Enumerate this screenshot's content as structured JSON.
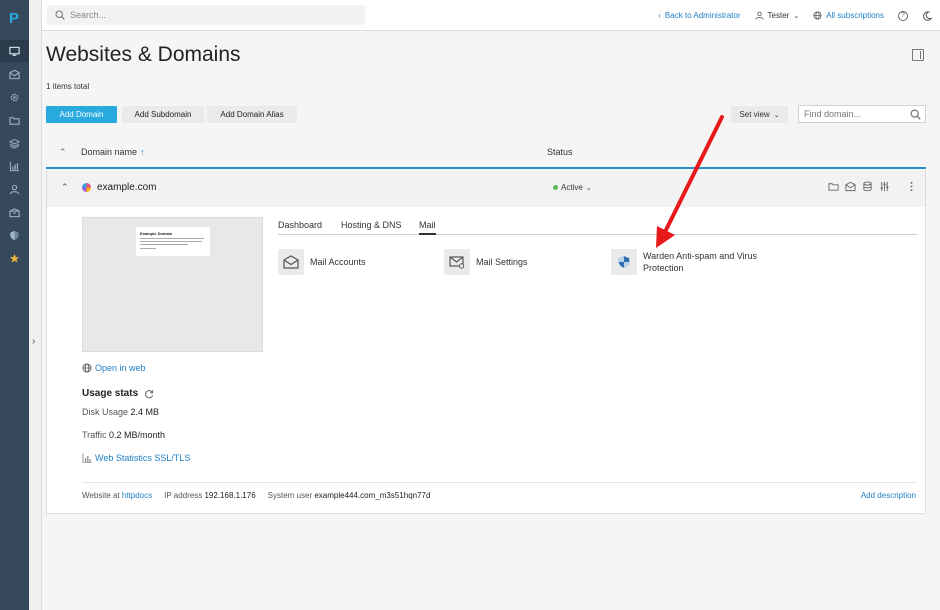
{
  "topbar": {
    "search_placeholder": "Search...",
    "back_to_admin": "Back to Administrator",
    "user": "Tester",
    "all_subscriptions": "All subscriptions"
  },
  "sidebar": {
    "logo": "P",
    "items": [
      "monitor-icon",
      "mail-icon",
      "gear-icon",
      "folder-icon",
      "layers-icon",
      "chart-icon",
      "user-icon",
      "box-icon",
      "shield-icon",
      "star-icon"
    ]
  },
  "page": {
    "title": "Websites & Domains",
    "items_total": "1 items total"
  },
  "toolbar": {
    "add_domain": "Add Domain",
    "add_subdomain": "Add Subdomain",
    "add_domain_alias": "Add Domain Alias",
    "set_view": "Set view",
    "find_placeholder": "Find domain..."
  },
  "table": {
    "col_name": "Domain name",
    "col_name_sort": "↑",
    "col_status": "Status"
  },
  "domain": {
    "name": "example.com",
    "status": "Active",
    "preview_title": "Example Domain",
    "open_in_web": "Open in web",
    "usage_title": "Usage stats",
    "disk_label": "Disk Usage",
    "disk_value": "2.4 MB",
    "traffic_label": "Traffic",
    "traffic_value": "0.2 MB/month",
    "web_stats": "Web Statistics SSL/TLS",
    "tabs": [
      "Dashboard",
      "Hosting & DNS",
      "Mail"
    ],
    "active_tab": "Mail",
    "tools": {
      "mail_accounts": "Mail Accounts",
      "mail_settings": "Mail Settings",
      "warden_line1": "Warden Anti-spam and Virus",
      "warden_line2": "Protection"
    },
    "footer": {
      "website_at_label": "Website at",
      "website_at_value": "httpdocs",
      "ip_label": "IP address",
      "ip_value": "192.168.1.176",
      "sysuser_label": "System user",
      "sysuser_value": "example444.com_m3s51hqn77d",
      "add_description": "Add description"
    }
  },
  "colors": {
    "sidebar": "#36495c",
    "accent": "#28aade",
    "link": "#1f7fc4",
    "active_dot": "#5cb85c",
    "arrow": "#e8191b"
  }
}
